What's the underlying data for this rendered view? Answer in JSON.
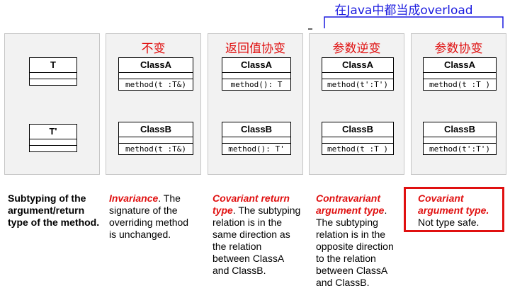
{
  "top_note": "在Java中都当成overload",
  "panels": [
    {
      "title": "",
      "top_class": "T",
      "bottom_class": "T'",
      "top_method": "",
      "bottom_method": ""
    },
    {
      "title": "不变",
      "top_class": "ClassA",
      "top_method": "method(t :T&)",
      "bottom_class": "ClassB",
      "bottom_method": "method(t :T&)"
    },
    {
      "title": "返回值协变",
      "top_class": "ClassA",
      "top_method": "method(): T",
      "bottom_class": "ClassB",
      "bottom_method": "method(): T'"
    },
    {
      "title": "参数逆变",
      "top_class": "ClassA",
      "top_method": "method(t':T')",
      "bottom_class": "ClassB",
      "bottom_method": "method(t :T )"
    },
    {
      "title": "参数协变",
      "top_class": "ClassA",
      "top_method": "method(t :T )",
      "bottom_class": "ClassB",
      "bottom_method": "method(t':T')"
    }
  ],
  "descriptions": {
    "d1": "Subtyping of the argument/return type of the method.",
    "d2_em": "Invariance",
    "d2_rest": ". The signature of the overriding method is unchanged.",
    "d3_em": "Covariant return type",
    "d3_rest": ". The subtyping relation is in the same direction as the relation between ClassA and ClassB.",
    "d4_em": "Contravariant argument type",
    "d4_rest": ". The subtyping relation is in the opposite direction to the relation between ClassA and ClassB.",
    "d5_em": "Covariant argument type.",
    "d5_rest": "Not type safe."
  },
  "colors": {
    "title_red": "#e01010",
    "blue": "#1a1adf",
    "orange": "#f0a040",
    "faint_orange": "#f5c89a"
  }
}
